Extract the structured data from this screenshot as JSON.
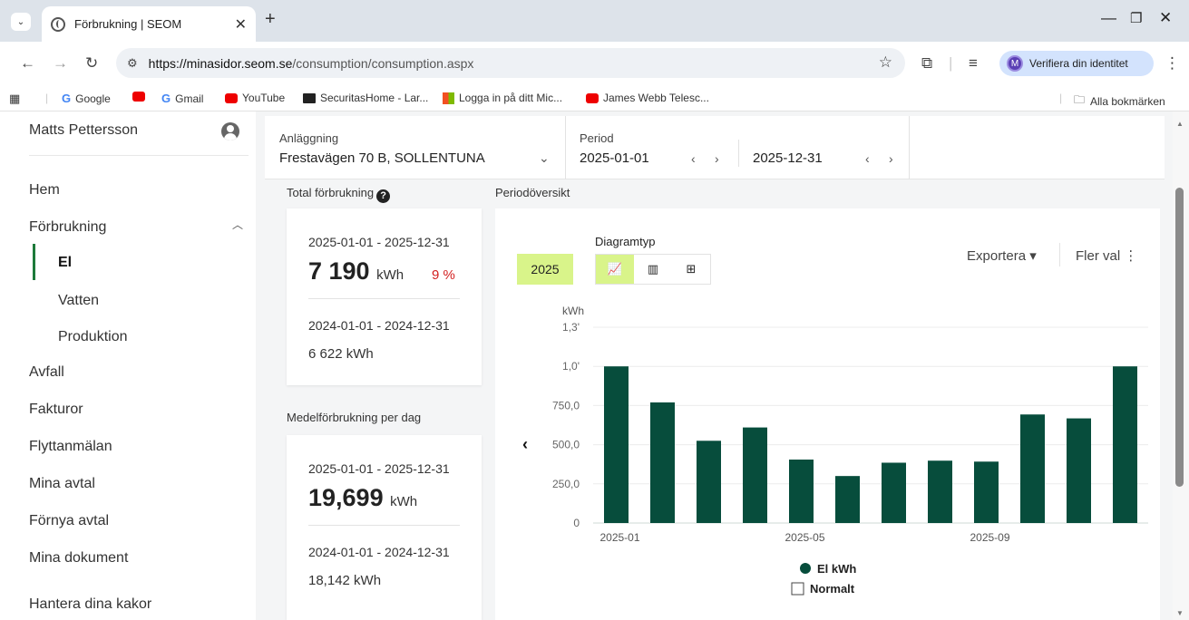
{
  "browser": {
    "tab_title": "Förbrukning | SEOM",
    "url_host": "https://minasidor.seom.se",
    "url_path": "/consumption/consumption.aspx",
    "verify_label": "Verifiera din identitet",
    "profile_initial": "M",
    "bookmarks": [
      "Google",
      "Gmail",
      "YouTube",
      "SecuritasHome - Lar...",
      "Logga in på ditt Mic...",
      "James Webb Telesc..."
    ],
    "all_bookmarks": "Alla bokmärken"
  },
  "sidebar": {
    "user_name": "Matts Pettersson",
    "items": [
      {
        "label": "Hem"
      },
      {
        "label": "Förbrukning"
      },
      {
        "label": "El"
      },
      {
        "label": "Vatten"
      },
      {
        "label": "Produktion"
      },
      {
        "label": "Avfall"
      },
      {
        "label": "Fakturor"
      },
      {
        "label": "Flyttanmälan"
      },
      {
        "label": "Mina avtal"
      },
      {
        "label": "Förnya avtal"
      },
      {
        "label": "Mina dokument"
      },
      {
        "label": "Hantera dina kakor"
      }
    ]
  },
  "filters": {
    "facility_label": "Anläggning",
    "facility_value": "Frestavägen 70 B, SOLLENTUNA",
    "period_label": "Period",
    "period_start": "2025-01-01",
    "period_end": "2025-12-31"
  },
  "total": {
    "title": "Total förbrukning",
    "current_range": "2025-01-01 - 2025-12-31",
    "current_value": "7 190",
    "unit": "kWh",
    "change": "9 %",
    "previous_range": "2024-01-01 - 2024-12-31",
    "previous_value": "6 622 kWh"
  },
  "average": {
    "title": "Medelförbrukning per dag",
    "current_range": "2025-01-01 - 2025-12-31",
    "current_value": "19,699",
    "unit": "kWh",
    "previous_range": "2024-01-01 - 2024-12-31",
    "previous_value": "18,142 kWh"
  },
  "overview": {
    "title": "Periodöversikt",
    "year": "2025",
    "diagram_type_label": "Diagramtyp",
    "export_label": "Exportera",
    "more_label": "Fler val",
    "legend_normal": "Normalt"
  },
  "colors": {
    "bar": "#074d3c",
    "accent": "#d9f48a",
    "negative": "#d32020"
  },
  "chart_data": {
    "type": "bar",
    "ylabel": "kWh",
    "y_ticks": [
      "0",
      "250,0",
      "500,0",
      "750,0",
      "1,0'",
      "1,3'"
    ],
    "ylim": [
      0,
      1250
    ],
    "x_tick_labels": [
      "2025-01",
      "2025-05",
      "2025-09"
    ],
    "categories": [
      "2025-01",
      "2025-02",
      "2025-03",
      "2025-04",
      "2025-05",
      "2025-06",
      "2025-07",
      "2025-08",
      "2025-09",
      "2025-10",
      "2025-11",
      "2025-12"
    ],
    "series": [
      {
        "name": "El kWh",
        "values": [
          1000,
          770,
          525,
          610,
          405,
          300,
          385,
          398,
          392,
          693,
          668,
          1000
        ]
      }
    ],
    "grid": true,
    "legend_position": "bottom-center"
  }
}
